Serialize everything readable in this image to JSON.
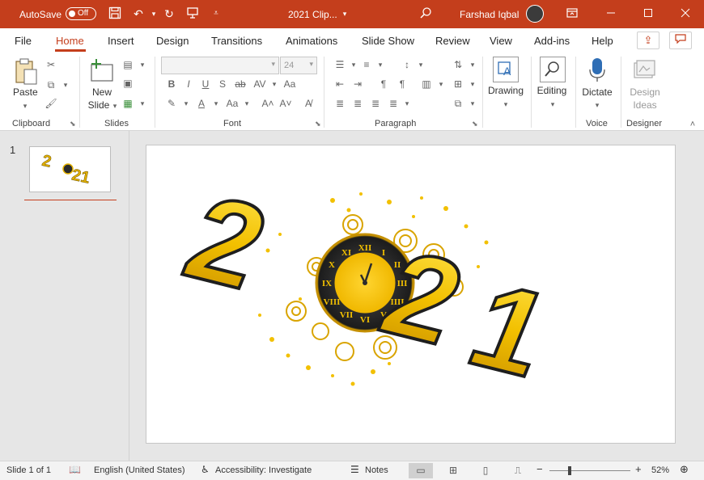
{
  "titlebar": {
    "autosave_label": "AutoSave",
    "autosave_state": "Off",
    "doc_title": "2021 Clip...",
    "user_name": "Farshad Iqbal",
    "accent_color": "#c43e1c"
  },
  "tabs": [
    {
      "label": "File"
    },
    {
      "label": "Home"
    },
    {
      "label": "Insert"
    },
    {
      "label": "Design"
    },
    {
      "label": "Transitions"
    },
    {
      "label": "Animations"
    },
    {
      "label": "Slide Show"
    },
    {
      "label": "Review"
    },
    {
      "label": "View"
    },
    {
      "label": "Add-ins"
    },
    {
      "label": "Help"
    }
  ],
  "ribbon": {
    "clipboard": {
      "paste_label": "Paste",
      "group_label": "Clipboard"
    },
    "slides": {
      "new_slide_label": "New",
      "new_slide_label2": "Slide",
      "group_label": "Slides"
    },
    "font": {
      "size_value": "24",
      "group_label": "Font"
    },
    "paragraph": {
      "group_label": "Paragraph"
    },
    "drawing": {
      "label": "Drawing"
    },
    "editing": {
      "label": "Editing"
    },
    "voice": {
      "dictate_label": "Dictate",
      "group_label": "Voice"
    },
    "designer": {
      "design_ideas_label": "Design",
      "design_ideas_label2": "Ideas",
      "group_label": "Designer"
    }
  },
  "thumbnails": [
    {
      "number": "1"
    }
  ],
  "slide": {
    "graphic_text": "2021",
    "clock_numerals": [
      "XII",
      "I",
      "II",
      "III",
      "IIII",
      "V",
      "VI",
      "VII",
      "VIII",
      "IX",
      "X",
      "XI"
    ]
  },
  "statusbar": {
    "slide_info": "Slide 1 of 1",
    "language": "English (United States)",
    "accessibility": "Accessibility: Investigate",
    "notes_label": "Notes",
    "zoom_level": "52%"
  }
}
